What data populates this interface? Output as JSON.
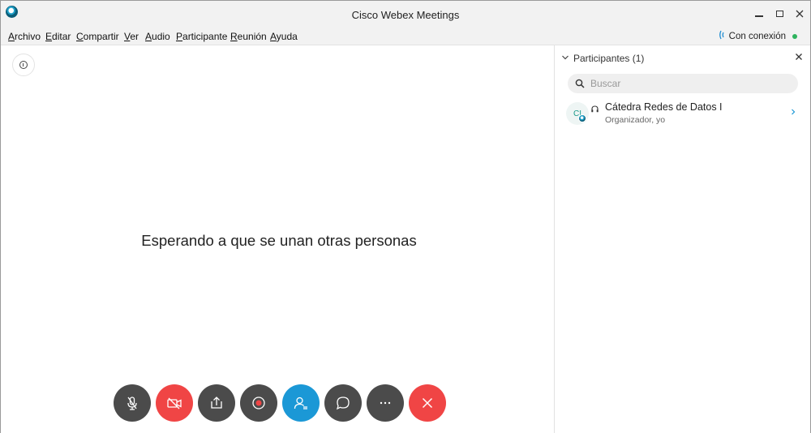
{
  "window": {
    "title": "Cisco Webex Meetings"
  },
  "menu": [
    "Archivo",
    "Editar",
    "Compartir",
    "Ver",
    "Audio",
    "Participante",
    "Reunión",
    "Ayuda"
  ],
  "connection": {
    "label": "Con conexión",
    "status_color": "#2db35d"
  },
  "stage": {
    "waiting_text": "Esperando a que se unan otras personas"
  },
  "controls": [
    {
      "name": "mute-button",
      "icon": "mic-off-icon"
    },
    {
      "name": "video-button",
      "icon": "video-off-icon"
    },
    {
      "name": "share-button",
      "icon": "share-icon"
    },
    {
      "name": "record-button",
      "icon": "record-icon"
    },
    {
      "name": "participants-button",
      "icon": "participants-icon"
    },
    {
      "name": "chat-button",
      "icon": "chat-icon"
    },
    {
      "name": "more-button",
      "icon": "more-icon"
    },
    {
      "name": "leave-button",
      "icon": "close-icon"
    }
  ],
  "colors": {
    "accent": "#1b98d6",
    "danger": "#f04545",
    "control_dark": "#4b4b4b"
  },
  "participants_panel": {
    "title": "Participantes (1)",
    "search_placeholder": "Buscar",
    "participants": [
      {
        "initials": "CI",
        "name": "Cátedra Redes de Datos I",
        "role": "Organizador, yo"
      }
    ]
  }
}
